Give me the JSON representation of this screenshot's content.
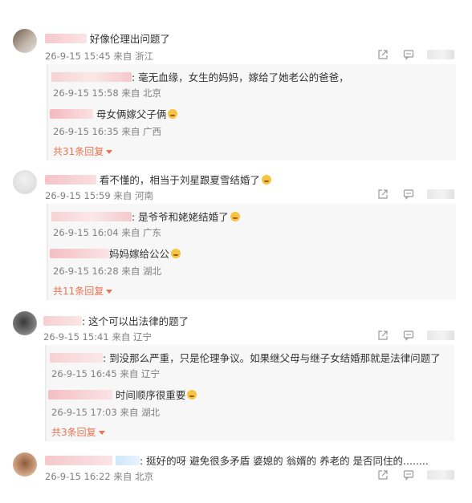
{
  "threads": [
    {
      "text": "好像伦理出问题了",
      "meta": "26-9-15 15:45 来自 浙江",
      "replies": [
        {
          "text": ": 毫无血缘，女生的妈妈，嫁给了她老公的爸爸，",
          "meta": "26-9-15 15:58 来自 北京"
        },
        {
          "text": "母女俩嫁父子俩",
          "meta": "26-9-15 16:35 来自 广西",
          "emoji": "smile-emoji-icon"
        }
      ],
      "more": "共31条回复"
    },
    {
      "text": "看不懂的，相当于刘星跟夏雪结婚了",
      "meta": "26-9-15 15:59 来自 河南",
      "replies": [
        {
          "text": ": 是爷爷和姥姥结婚了",
          "meta": "26-9-15 16:04 来自 广东"
        },
        {
          "text": "妈妈嫁给公公",
          "meta": "26-9-15 16:28 来自 湖北"
        }
      ],
      "more": "共11条回复"
    },
    {
      "text": ": 这个可以出法律的题了",
      "meta": "26-9-15 15:41 来自 辽宁",
      "replies": [
        {
          "text": ": 到没那么严重，只是伦理争议。如果继父母与继子女结婚那就是法律问题了",
          "meta": "26-9-15 16:45 来自 辽宁"
        },
        {
          "text": "时间顺序很重要",
          "meta": "26-9-15 17:03 来自 湖北"
        }
      ],
      "more": "共3条回复"
    },
    {
      "text": ": 挺好的呀  避免很多矛盾 婆媳的 翁婿的 养老的  是否同住的........",
      "meta": "26-9-15 16:22 来自 北京"
    }
  ]
}
